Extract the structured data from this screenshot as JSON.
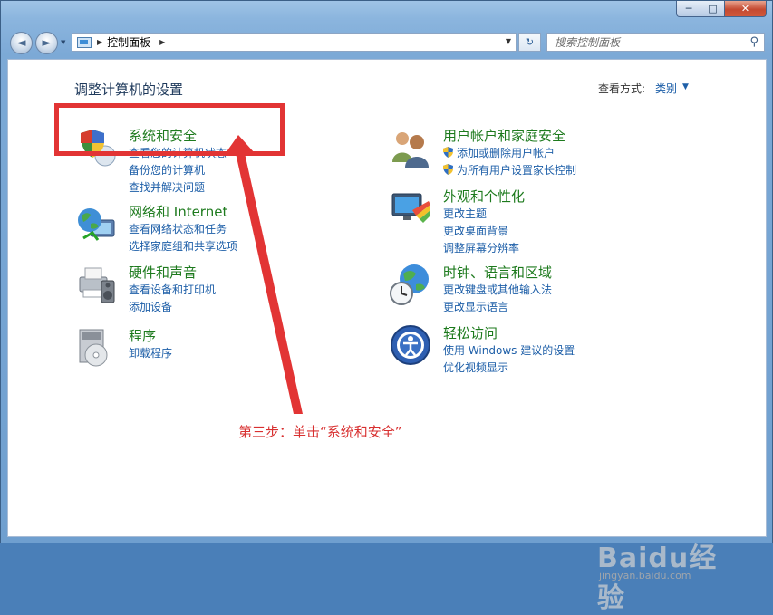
{
  "window": {
    "caption_min": "─",
    "caption_max": "□",
    "caption_close": "✕"
  },
  "nav": {
    "back_glyph": "◄",
    "forward_glyph": "►",
    "dropdown_glyph": "▼"
  },
  "address": {
    "breadcrumb_root_glyph": "▶",
    "location": "控制面板",
    "separator_glyph": "▶",
    "dropdown_glyph": "▼",
    "refresh_glyph": "↻"
  },
  "search": {
    "placeholder": "搜索控制面板",
    "icon_glyph": "⚲"
  },
  "page": {
    "title": "调整计算机的设置",
    "view_by_label": "查看方式:",
    "view_by_value": "类别",
    "view_by_dropdown_glyph": "▼"
  },
  "categories": [
    {
      "title": "系统和安全",
      "icon": "system-security-shield-icon",
      "links": [
        "查看您的计算机状态",
        "备份您的计算机",
        "查找并解决问题"
      ]
    },
    {
      "title": "网络和 Internet",
      "icon": "network-globe-icon",
      "links": [
        "查看网络状态和任务",
        "选择家庭组和共享选项"
      ]
    },
    {
      "title": "硬件和声音",
      "icon": "printer-speaker-icon",
      "links": [
        "查看设备和打印机",
        "添加设备"
      ]
    },
    {
      "title": "程序",
      "icon": "programs-disc-icon",
      "links": [
        "卸载程序"
      ]
    },
    {
      "title": "用户帐户和家庭安全",
      "icon": "users-icon",
      "links": [
        "添加或删除用户帐户",
        "为所有用户设置家长控制"
      ]
    },
    {
      "title": "外观和个性化",
      "icon": "appearance-monitor-icon",
      "links": [
        "更改主题",
        "更改桌面背景",
        "调整屏幕分辨率"
      ]
    },
    {
      "title": "时钟、语言和区域",
      "icon": "clock-globe-icon",
      "links": [
        "更改键盘或其他输入法",
        "更改显示语言"
      ]
    },
    {
      "title": "轻松访问",
      "icon": "ease-of-access-icon",
      "links": [
        "使用 Windows 建议的设置",
        "优化视频显示"
      ]
    }
  ],
  "annotation": {
    "text": "第三步：单击“系统和安全”",
    "color": "#e23434"
  },
  "watermark": {
    "logo_text": "Baidu经验",
    "url": "jingyan.baidu.com"
  },
  "colors": {
    "category_title": "#1d7a1d",
    "link": "#1e5fa8",
    "window_frame": "#7ca9d6"
  }
}
